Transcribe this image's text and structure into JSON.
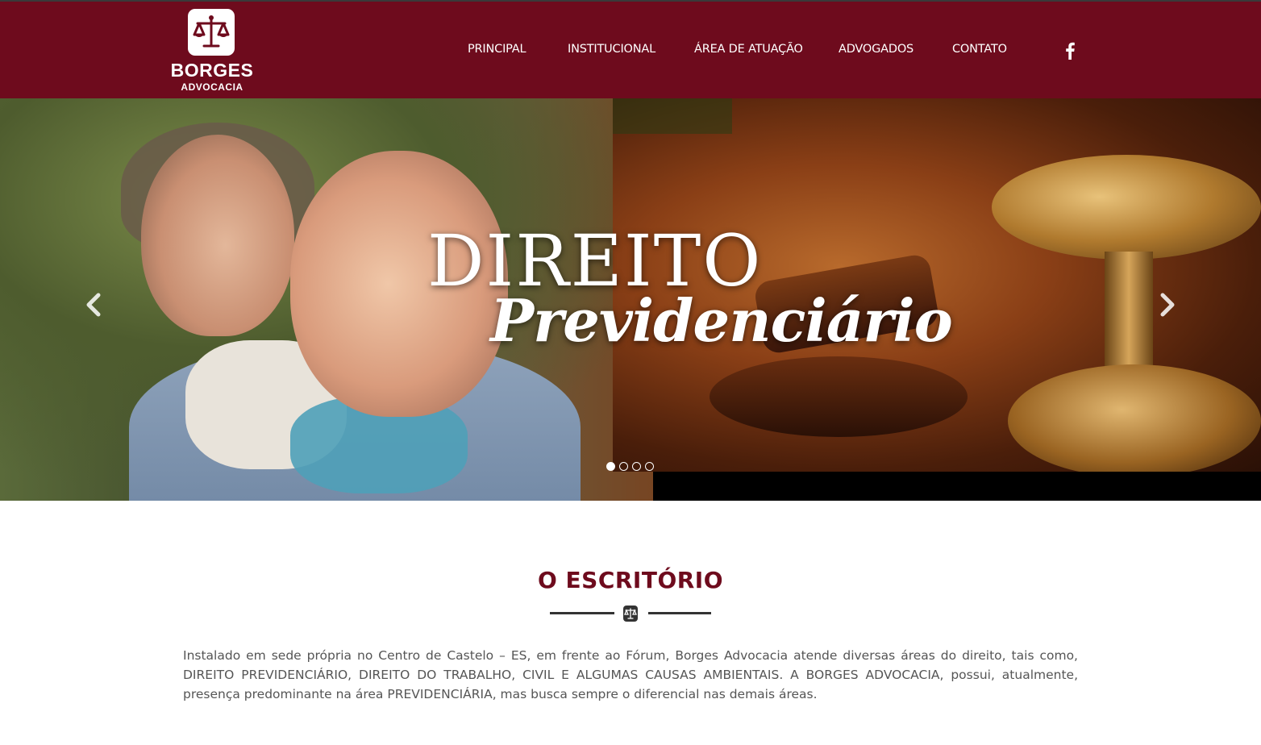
{
  "brand": {
    "name": "BORGES",
    "tagline": "ADVOCACIA",
    "color": "#6e0b1d"
  },
  "nav": {
    "items": [
      {
        "label": "PRINCIPAL"
      },
      {
        "label": "INSTITUCIONAL"
      },
      {
        "label": "ÁREA DE ATUAÇÃO"
      },
      {
        "label": "ADVOGADOS"
      },
      {
        "label": "CONTATO"
      }
    ],
    "social_icon": "facebook-icon"
  },
  "hero": {
    "title": "DIREITO",
    "subtitle": "Previdenciário",
    "prev_icon": "chevron-left-icon",
    "next_icon": "chevron-right-icon",
    "slide_count": 4,
    "active_slide": 1
  },
  "section": {
    "title": "O ESCRITÓRIO",
    "divider_icon": "scales-icon",
    "body": "Instalado em sede própria no Centro de Castelo – ES, em frente ao Fórum, Borges Advocacia atende diversas áreas do direito, tais como, DIREITO PREVIDENCIÁRIO, DIREITO DO TRABALHO, CIVIL E ALGUMAS CAUSAS AMBIENTAIS. A BORGES ADVOCACIA, possui, atualmente, presença predominante na área PREVIDENCIÁRIA, mas busca sempre o diferencial nas demais áreas."
  }
}
